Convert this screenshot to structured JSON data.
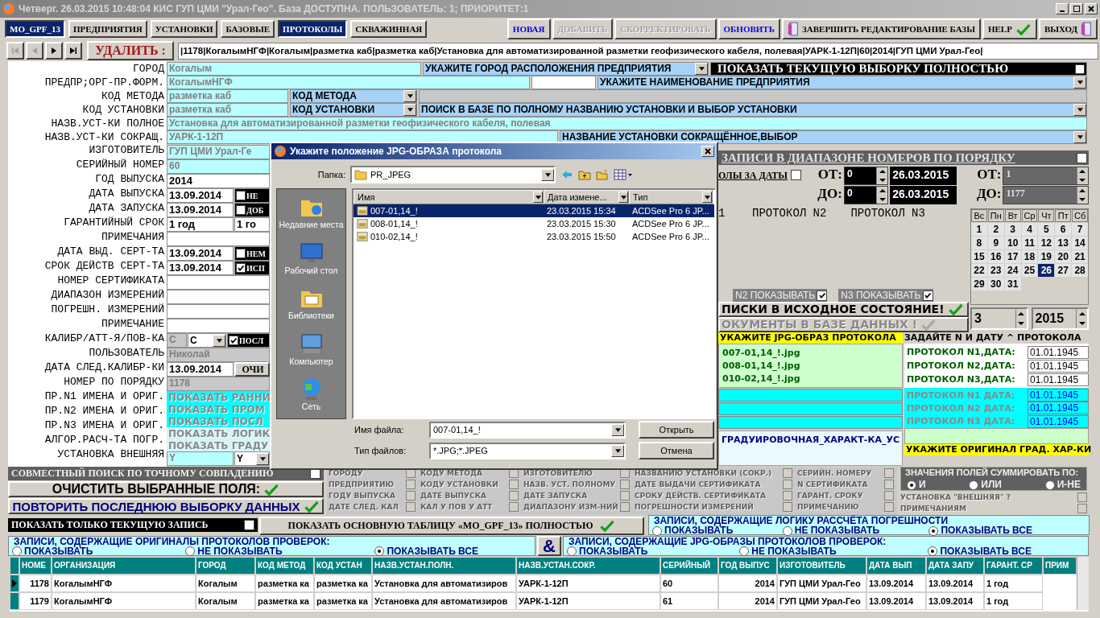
{
  "window": {
    "title": "Четверг. 26.03.2015 10:48:04 КИС ГУП ЦМИ \"Урал-Гео\". База ДОСТУПНА. ПОЛЬЗОВАТЕЛЬ: 1; ПРИОРИТЕТ:1"
  },
  "tabs": [
    {
      "label": "MO_GPF_13",
      "selected": true
    },
    {
      "label": "ПРЕДПРИЯТИЯ",
      "selected": false
    },
    {
      "label": "УСТАНОВКИ",
      "selected": false
    },
    {
      "label": "БАЗОВЫЕ",
      "selected": false
    },
    {
      "label": "ПРОТОКОЛЫ",
      "selected": true
    },
    {
      "label": "СКВАЖИННАЯ",
      "selected": false
    }
  ],
  "actions": [
    {
      "label": "НОВАЯ",
      "kind": "link",
      "disabled": false
    },
    {
      "label": "ДОБАВИТЬ",
      "kind": "link",
      "disabled": true
    },
    {
      "label": "СКОРРЕКТИРОВАТЬ",
      "kind": "link",
      "disabled": true
    },
    {
      "label": "ОБНОВИТЬ",
      "kind": "link",
      "disabled": false
    },
    {
      "label": "ЗАВЕРШИТЬ РЕДАКТИРОВАНИЕ БАЗЫ",
      "kind": "finish"
    },
    {
      "label": "HELP",
      "kind": "help"
    },
    {
      "label": "ВЫХОД",
      "kind": "exit"
    }
  ],
  "nav": {
    "buttons": [
      {
        "kind": "first",
        "disabled": true
      },
      {
        "kind": "prev",
        "disabled": true
      },
      {
        "kind": "next",
        "disabled": false
      },
      {
        "kind": "last",
        "disabled": false
      }
    ],
    "delete_label": "УДАЛИТЬ :",
    "record": "|1178|КогалымНГФ|Когалым|разметка каб|разметка каб|Установка для автоматизированной разметки геофизического кабеля, полевая|УАРК-1-12П|60|2014|ГУП ЦМИ Урал-Гео|"
  },
  "form": {
    "labels": [
      "ГОРОД",
      "ПРЕДПР;ОРГ-ПР.ФОРМ.",
      "КОД МЕТОДА",
      "КОД УСТАНОВКИ",
      "НАЗВ.УСТ-КИ ПОЛНОЕ",
      "НАЗВ.УСТ-КИ СОКРАЩ.",
      "ИЗГОТОВИТЕЛЬ",
      "СЕРИЙНЫЙ НОМЕР",
      "ГОД ВЫПУСКА",
      "ДАТА ВЫПУСКА",
      "ДАТА ЗАПУСКА",
      "ГАРАНТИЙНЫЙ СРОК",
      "ПРИМЕЧАНИЯ",
      "ДАТА ВЫД. СЕРТ-ТА",
      "СРОК ДЕЙСТВ СЕРТ-ТА",
      "НОМЕР СЕРТИФИКАТА",
      "ДИАПАЗОН ИЗМЕРЕНИЙ",
      "ПОГРЕШН. ИЗМЕРЕНИЙ",
      "ПРИМЕЧАНИЕ",
      "КАЛИБР/АТТ-Я/ПОВ-КА",
      "ПОЛЬЗОВАТЕЛЬ",
      "ДАТА СЛЕД.КАЛИБР-КИ",
      "НОМЕР ПО ПОРЯДКУ",
      "ПР.N1 ИМЕНА И ОРИГ.",
      "ПР.N2 ИМЕНА И ОРИГ.",
      "ПР.N3 ИМЕНА И ОРИГ.",
      "АЛГОР.РАСЧ-ТА ПОГР.",
      "УСТАНОВКА ВНЕШНЯЯ"
    ],
    "top_rows": [
      {
        "parts": [
          {
            "kind": "field",
            "text": "Когалым"
          },
          {
            "kind": "combo",
            "text": "УКАЖИТЕ ГОРОД РАСПОЛОЖЕНИЯ ПРЕДПРИЯТИЯ"
          },
          {
            "kind": "blackcheck",
            "text": "ПОКАЗАТЬ ТЕКУЩУЮ ВЫБОРКУ ПОЛНОСТЬЮ",
            "checked": false
          }
        ]
      },
      {
        "parts": [
          {
            "kind": "field",
            "text": "КогалымНГФ"
          },
          {
            "kind": "blank"
          },
          {
            "kind": "combo",
            "text": "УКАЖИТЕ НАИМЕНОВАНИЕ ПРЕДПРИЯТИЯ"
          }
        ]
      },
      {
        "parts": [
          {
            "kind": "field",
            "text": "разметка каб"
          },
          {
            "kind": "combo",
            "text": "КОД МЕТОДА"
          },
          {
            "kind": "panel"
          }
        ]
      },
      {
        "parts": [
          {
            "kind": "field",
            "text": "разметка каб"
          },
          {
            "kind": "combo",
            "text": "КОД УСТАНОВКИ"
          },
          {
            "kind": "combo",
            "text": "ПОИСК В БАЗЕ ПО ПОЛНОМУ НАЗВАНИЮ УСТАНОВКИ И ВЫБОР УСТАНОВКИ"
          }
        ]
      },
      {
        "parts": [
          {
            "kind": "field",
            "text": "Установка для автоматизированной разметки геофизического кабеля, полевая"
          }
        ]
      },
      {
        "parts": [
          {
            "kind": "field",
            "text": "УАРК-1-12П"
          },
          {
            "kind": "combo",
            "text": "НАЗВАНИЕ УСТАНОВКИ СОКРАЩЁННОЕ,ВЫБОР"
          }
        ]
      }
    ],
    "lower_rows": [
      {
        "parts": [
          {
            "kind": "field",
            "text": "ГУП ЦМИ Урал-Ге"
          }
        ]
      },
      {
        "parts": [
          {
            "kind": "field",
            "text": "60"
          }
        ]
      },
      {
        "parts": [
          {
            "kind": "input",
            "text": "2014"
          }
        ]
      },
      {
        "parts": [
          {
            "kind": "input",
            "text": "13.09.2014"
          },
          {
            "kind": "blackcheck",
            "text": "НЕ",
            "checked": false
          }
        ]
      },
      {
        "parts": [
          {
            "kind": "input",
            "text": "13.09.2014"
          },
          {
            "kind": "blackcheck",
            "text": "ДОБ",
            "checked": false
          }
        ]
      },
      {
        "parts": [
          {
            "kind": "input",
            "text": "1 год"
          },
          {
            "kind": "input",
            "text": "1 го"
          }
        ]
      },
      {
        "parts": [
          {
            "kind": "blank"
          }
        ]
      },
      {
        "parts": [
          {
            "kind": "input",
            "text": "13.09.2014"
          },
          {
            "kind": "blackcheck",
            "text": "НЕМ",
            "checked": false
          }
        ]
      },
      {
        "parts": [
          {
            "kind": "input",
            "text": "13.09.2014"
          },
          {
            "kind": "blackcheck",
            "text": "ИСП",
            "checked": true
          }
        ]
      },
      {
        "parts": [
          {
            "kind": "blank"
          }
        ]
      },
      {
        "parts": [
          {
            "kind": "blank"
          }
        ]
      },
      {
        "parts": [
          {
            "kind": "blank"
          }
        ]
      },
      {
        "parts": [
          {
            "kind": "blank"
          }
        ]
      },
      {
        "parts": [
          {
            "kind": "dim",
            "text": "С"
          },
          {
            "kind": "minicombo",
            "text": "С"
          },
          {
            "kind": "blackcheck",
            "text": "ПОСЛ",
            "checked": true
          }
        ]
      },
      {
        "parts": [
          {
            "kind": "dim",
            "text": "Николай"
          }
        ]
      },
      {
        "parts": [
          {
            "kind": "input",
            "text": "13.09.2014"
          },
          {
            "kind": "button",
            "text": "ОЧИ"
          }
        ]
      },
      {
        "parts": [
          {
            "kind": "dim",
            "text": "1178"
          }
        ]
      },
      {
        "parts": [
          {
            "kind": "cta",
            "text": "ПОКАЗАТЬ РАННИ"
          }
        ]
      },
      {
        "parts": [
          {
            "kind": "cta",
            "text": "ПОКАЗАТЬ ПРОМ"
          }
        ]
      },
      {
        "parts": [
          {
            "kind": "cta",
            "text": "ПОКАЗАТЬ ПОСЛ"
          }
        ]
      },
      {
        "parts": [
          {
            "kind": "pale",
            "text": "ПОКАЗАТЬ ЛОГИК"
          }
        ]
      },
      {
        "parts": [
          {
            "kind": "pale",
            "text": "ПОКАЗАТЬ ГРАДУ"
          }
        ]
      },
      {
        "parts": [
          {
            "kind": "field",
            "text": "Y"
          },
          {
            "kind": "minicombo",
            "text": "Y"
          }
        ]
      }
    ]
  },
  "range": {
    "title": "ЗАПИСИ В ДИАПАЗОНЕ НОМЕРОВ ПО ПОРЯДКУ",
    "checked": false,
    "dates_label": "ОЛЫ ЗА ДАТЫ",
    "dates_checked": false,
    "from_label": "ОТ:",
    "to_label": "ДО:",
    "from_num": "0",
    "to_num": "0",
    "from_date": "26.03.2015",
    "to_date": "26.03.2015",
    "rec_from_label": "ОТ:",
    "rec_to_label": "ДО:",
    "rec_from": "1",
    "rec_to": "1177"
  },
  "protocols_header": [
    "1",
    "ПРОТОКОЛ N2",
    "ПРОТОКОЛ N3"
  ],
  "show_toggles": [
    {
      "label": "N2 ПОКАЗЫВАТЬ",
      "checked": true
    },
    {
      "label": "N3 ПОКАЗЫВАТЬ",
      "checked": true
    }
  ],
  "panel_buttons": [
    {
      "label": "ПИСКИ В ИСХОДНОЕ СОСТОЯНИЕ!",
      "disabled": false
    },
    {
      "label": "ОКУМЕНТЫ В БАЗЕ ДАННЫХ !",
      "disabled": true
    }
  ],
  "calendar": {
    "weekdays": [
      "Вс",
      "Пн",
      "Вт",
      "Ср",
      "Чт",
      "Пт",
      "Сб"
    ],
    "weeks": [
      [
        {
          "day": "1",
          "selected": false
        },
        {
          "day": "2",
          "selected": false
        },
        {
          "day": "3",
          "selected": false
        },
        {
          "day": "4",
          "selected": false
        },
        {
          "day": "5",
          "selected": false
        },
        {
          "day": "6",
          "selected": false
        },
        {
          "day": "7",
          "selected": false
        }
      ],
      [
        {
          "day": "8",
          "selected": false
        },
        {
          "day": "9",
          "selected": false
        },
        {
          "day": "10",
          "selected": false
        },
        {
          "day": "11",
          "selected": false
        },
        {
          "day": "12",
          "selected": false
        },
        {
          "day": "13",
          "selected": false
        },
        {
          "day": "14",
          "selected": false
        }
      ],
      [
        {
          "day": "15",
          "selected": false
        },
        {
          "day": "16",
          "selected": false
        },
        {
          "day": "17",
          "selected": false
        },
        {
          "day": "18",
          "selected": false
        },
        {
          "day": "19",
          "selected": false
        },
        {
          "day": "20",
          "selected": false
        },
        {
          "day": "21",
          "selected": false
        }
      ],
      [
        {
          "day": "22",
          "selected": false
        },
        {
          "day": "23",
          "selected": false
        },
        {
          "day": "24",
          "selected": false
        },
        {
          "day": "25",
          "selected": false
        },
        {
          "day": "26",
          "selected": true
        },
        {
          "day": "27",
          "selected": false
        },
        {
          "day": "28",
          "selected": false
        }
      ],
      [
        {
          "day": "29",
          "selected": false
        },
        {
          "day": "30",
          "selected": false
        },
        {
          "day": "31",
          "selected": false
        }
      ]
    ],
    "month": "3",
    "year": "2015"
  },
  "jpg": {
    "title": "УКАЖИТЕ JPG-ОБРАЗ ПРОТОКОЛА",
    "files": [
      "007-01,14_!.jpg",
      "008-01,14_!.jpg",
      "010-02,14_!.jpg"
    ],
    "grad": "ГРАДУИРОВОЧНАЯ_ХАРАКТ-КА_УС"
  },
  "dates": {
    "title": "ЗАДАЙТЕ N И ДАТУ ^ ПРОТОКОЛА",
    "set": [
      {
        "label": "ПРОТОКОЛ N1,ДАТА:",
        "date": "01.01.1945"
      },
      {
        "label": "ПРОТОКОЛ N2,ДАТА:",
        "date": "01.01.1945"
      },
      {
        "label": "ПРОТОКОЛ N3,ДАТА:",
        "date": "01.01.1945"
      }
    ],
    "orig": [
      {
        "label": "ПРОТОКОЛ N1 ДАТА:",
        "date": "01.01.1945"
      },
      {
        "label": "ПРОТОКОЛ N2 ДАТА:",
        "date": "01.01.1945"
      },
      {
        "label": "ПРОТОКОЛ N3 ДАТА:",
        "date": "01.01.1945"
      }
    ],
    "grad_title": "УКАЖИТЕ ОРИГИНАЛ ГРАД. ХАР-КИ"
  },
  "joint": {
    "label": "СОВМЕСТНЫЙ ПОИСК ПО ТОЧНОМУ СОВПАДЕНИЮ",
    "checked": false
  },
  "clear_button": "ОЧИСТИТЬ ВЫБРАННЫЕ ПОЛЯ:",
  "repeat_button": "ПОВТОРИТЬ ПОСЛЕДНЮЮ ВЫБОРКУ ДАННЫХ",
  "search_by": {
    "disabled": true,
    "columns": [
      {
        "items": [
          {
            "label": "ГОРОДУ",
            "checked": false
          },
          {
            "label": "ПРЕДПРИЯТИЮ",
            "checked": false
          },
          {
            "label": "ГОДУ ВЫПУСКА",
            "checked": false
          },
          {
            "label": "ДАТЕ СЛЕД. КАЛ",
            "checked": false
          }
        ]
      },
      {
        "items": [
          {
            "label": "КОДУ МЕТОДА",
            "checked": false
          },
          {
            "label": "КОДУ УСТАНОВКИ",
            "checked": false
          },
          {
            "label": "ДАТЕ ВЫПУСКА",
            "checked": false
          },
          {
            "label": "КАЛ У ПОВ У АТТ",
            "checked": false
          }
        ]
      },
      {
        "items": [
          {
            "label": "ИЗГОТОВИТЕЛЮ",
            "checked": false
          },
          {
            "label": "НАЗВ. УСТ. ПОЛНОМУ",
            "checked": false
          },
          {
            "label": "ДАТЕ ЗАПУСКА",
            "checked": false
          },
          {
            "label": "ДИАПАЗОНУ ИЗМ-НИЙ",
            "checked": false
          }
        ]
      },
      {
        "items": [
          {
            "label": "НАЗВАНИЮ УСТАНОВКИ (СОКР.)",
            "checked": false
          },
          {
            "label": "ДАТЕ ВЫДАЧИ СЕРТИФИКАТА",
            "checked": false
          },
          {
            "label": "СРОКУ ДЕЙСТВ. СЕРТИФИКАТА",
            "checked": false
          },
          {
            "label": "ПОГРЕШНОСТИ ИЗМЕРЕНИЙ",
            "checked": false
          }
        ]
      },
      {
        "items": [
          {
            "label": "СЕРИЙН. НОМЕРУ",
            "checked": false
          },
          {
            "label": "N СЕРТИФИКАТА",
            "checked": false
          },
          {
            "label": "ГАРАНТ. СРОКУ",
            "checked": false
          },
          {
            "label": "ПРИМЕЧАНИЮ",
            "checked": false
          }
        ]
      }
    ]
  },
  "combine": {
    "title": "ЗНАЧЕНИЯ ПОЛЕЙ СУММИРОВАТЬ ПО:",
    "options": [
      {
        "label": "И",
        "selected": true
      },
      {
        "label": "ИЛИ",
        "selected": false
      },
      {
        "label": "И-НЕ",
        "selected": false
      }
    ]
  },
  "extra_by": [
    {
      "label": "УСТАНОВКА \"ВНЕШНЯЯ\" ?",
      "checked": false
    },
    {
      "label": "ПРИМЕЧАНИЯМ",
      "checked": false
    }
  ],
  "current_only": {
    "label": "ПОКАЗАТЬ ТОЛЬКО ТЕКУЩУЮ ЗАПИСЬ",
    "checked": false
  },
  "show_table_button": "ПОКАЗАТЬ ОСНОВНУЮ ТАБЛИЦУ «MO_GPF_13» ПОЛНОСТЬЮ",
  "filters": [
    {
      "title": "ЗАПИСИ, СОДЕРЖАЩИЕ ЛОГИКУ РАССЧЁТА ПОГРЕШНОСТИ",
      "options": [
        {
          "label": "ПОКАЗЫВАТЬ",
          "selected": false
        },
        {
          "label": "НЕ ПОКАЗЫВАТЬ",
          "selected": false
        },
        {
          "label": "ПОКАЗЫВАТЬ ВСЕ",
          "selected": true
        }
      ]
    },
    {
      "title": "ЗАПИСИ, СОДЕРЖАЩИЕ ОРИГИНАЛЫ ПРОТОКОЛОВ ПРОВЕРОК:",
      "options": [
        {
          "label": "ПОКАЗЫВАТЬ",
          "selected": false
        },
        {
          "label": "НЕ ПОКАЗЫВАТЬ",
          "selected": false
        },
        {
          "label": "ПОКАЗЫВАТЬ ВСЕ",
          "selected": true
        }
      ]
    },
    {
      "title": "ЗАПИСИ, СОДЕРЖАЩИЕ JPG-ОБРАЗЫ ПРОТОКОЛОВ ПРОВЕРОК:",
      "options": [
        {
          "label": "ПОКАЗЫВАТЬ",
          "selected": false
        },
        {
          "label": "НЕ ПОКАЗЫВАТЬ",
          "selected": false
        },
        {
          "label": "ПОКАЗЫВАТЬ ВСЕ",
          "selected": true
        }
      ]
    }
  ],
  "amp": "&",
  "table": {
    "columns": [
      "НОМЕ",
      "ОРГАНИЗАЦИЯ",
      "ГОРОД",
      "КОД МЕТОД",
      "КОД УСТАН",
      "НАЗВ.УСТАН.ПОЛН.",
      "НАЗВ.УСТАН.СОКР.",
      "СЕРИЙНЫЙ",
      "ГОД ВЫПУС",
      "ИЗГОТОВИТЕЛЬ",
      "ДАТА ВЫП",
      "ДАТА ЗАПУ",
      "ГАРАНТ. СР",
      "ПРИМ"
    ],
    "rows": [
      {
        "selected": true,
        "cells": [
          "1178",
          "КогалымНГФ",
          "Когалым",
          "разметка ка",
          "разметка ка",
          "Установка для автоматизиров",
          "УАРК-1-12П",
          "60",
          "2014",
          "ГУП ЦМИ Урал-Гео",
          "13.09.2014",
          "13.09.2014",
          "1 год"
        ]
      },
      {
        "selected": false,
        "cells": [
          "1179",
          "КогалымНГФ",
          "Когалым",
          "разметка ка",
          "разметка ка",
          "Установка для автоматизиров",
          "УАРК-1-12П",
          "61",
          "2014",
          "ГУП ЦМИ Урал-Гео",
          "13.09.2014",
          "13.09.2014",
          "1 год"
        ]
      }
    ]
  },
  "dialog": {
    "title": "Укажите положение JPG-ОБРАЗА протокола",
    "folder_label": "Папка:",
    "folder": "PR_JPEG",
    "places": [
      {
        "label": "Недавние места",
        "kind": "recent"
      },
      {
        "label": "Рабочий стол",
        "kind": "desktop"
      },
      {
        "label": "Библиотеки",
        "kind": "libraries"
      },
      {
        "label": "Компьютер",
        "kind": "computer"
      },
      {
        "label": "Сеть",
        "kind": "network"
      }
    ],
    "columns": [
      "Имя",
      "Дата измене...",
      "Тип"
    ],
    "files": [
      {
        "name": "007-01,14_!",
        "date": "23.03.2015 15:34",
        "type": "ACDSee Pro 6 JP...",
        "selected": true
      },
      {
        "name": "008-01,14_!",
        "date": "23.03.2015 15:30",
        "type": "ACDSee Pro 6 JP...",
        "selected": false
      },
      {
        "name": "010-02,14_!",
        "date": "23.03.2015 15:50",
        "type": "ACDSee Pro 6 JP...",
        "selected": false
      }
    ],
    "filename_label": "Имя файла:",
    "filename": "007-01,14_!",
    "filetype_label": "Тип файлов:",
    "filetype": "*.JPG;*.JPEG",
    "open": "Открыть",
    "cancel": "Отмена"
  }
}
